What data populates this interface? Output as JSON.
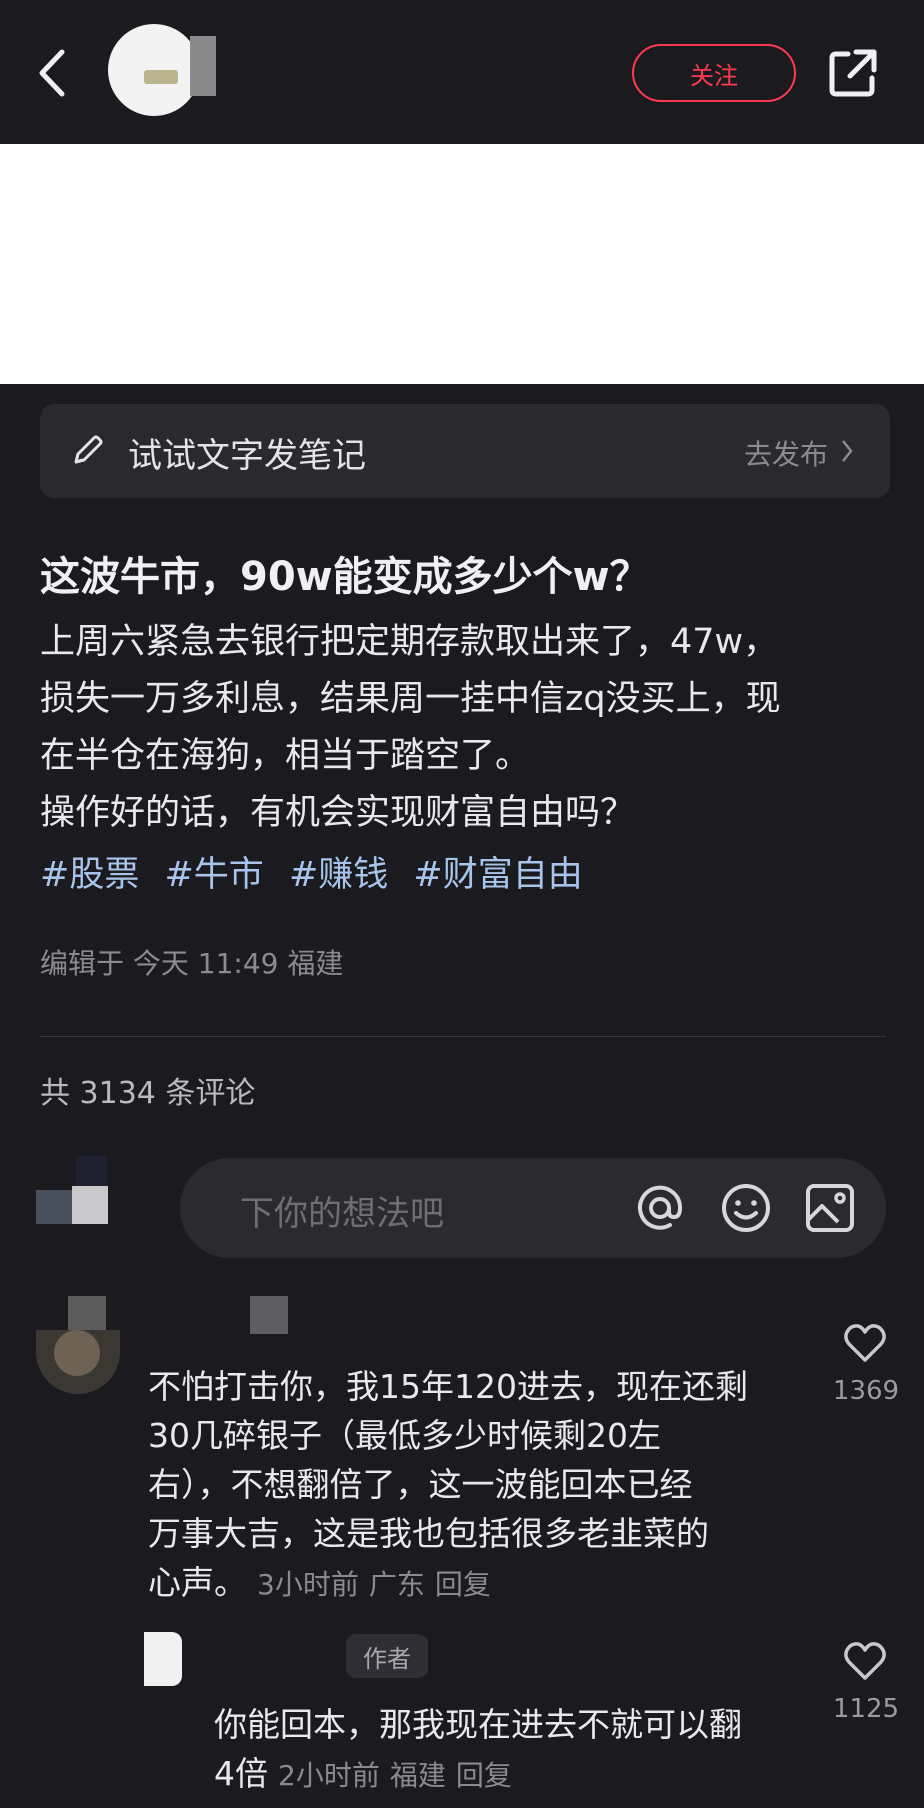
{
  "header": {
    "follow_label": "关注"
  },
  "composer": {
    "prompt": "试试文字发笔记",
    "action": "去发布"
  },
  "post": {
    "title": "这波牛市，90w能变成多少个w？",
    "body_lines": [
      "上周六紧急去银行把定期存款取出来了，47w，",
      "损失一万多利息，结果周一挂中信zq没买上，现",
      "在半仓在海狗，相当于踏空了。",
      "操作好的话，有机会实现财富自由吗？"
    ],
    "tags": [
      "#股票",
      "#牛市",
      "#赚钱",
      "#财富自由"
    ],
    "meta": "编辑于 今天 11:49 福建"
  },
  "comments_section": {
    "count_label": "共 3134 条评论",
    "input_placeholder": "下你的想法吧"
  },
  "comments": [
    {
      "text_lines": [
        "不怕打击你，我15年120进去，现在还剩",
        "30几碎银子（最低多少时候剩20左",
        "右），不想翻倍了，这一波能回本已经",
        "万事大吉，这是我也包括很多老韭菜的",
        "心声。"
      ],
      "time": "3小时前",
      "location": "广东",
      "reply_label": "回复",
      "likes": "1369"
    }
  ],
  "reply": {
    "badge": "作者",
    "text_lines": [
      "你能回本，那我现在进去不就可以翻",
      "4倍"
    ],
    "time": "2小时前",
    "location": "福建",
    "reply_label": "回复",
    "likes": "1125"
  }
}
